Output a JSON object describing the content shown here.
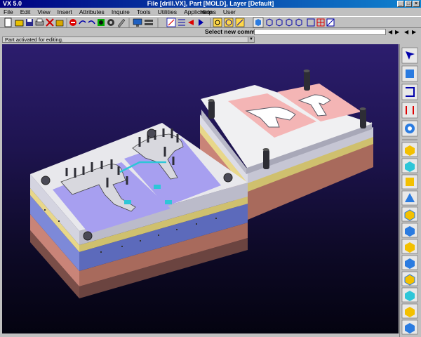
{
  "window": {
    "app_title": "VX 5.0",
    "doc_title": "File [drill.VX], Part [MOLD], Layer [Default]"
  },
  "menus": [
    "File",
    "Edit",
    "View",
    "Insert",
    "Attributes",
    "Inquire",
    "Tools",
    "Utilities",
    "Applications",
    "User"
  ],
  "help_menu": "Help",
  "command": {
    "label": "Select new command",
    "value": ""
  },
  "status": {
    "message": "Part activated for editing."
  },
  "colors": {
    "viewport_bg": "#1e1450",
    "plate_white": "#e8e8e8",
    "cavity_blue": "#a79ff0",
    "cavity_pink": "#f4b5b5",
    "base_brown": "#b07a6a",
    "plate_blue": "#7d89d8",
    "accent_cyan": "#2ec6d8"
  },
  "icons": {
    "toolbar": [
      "new-icon",
      "open-icon",
      "save-icon",
      "print-icon",
      "cut-icon",
      "folder-icon",
      "stop-icon",
      "redo-icon",
      "undo-icon",
      "move-icon",
      "gear-icon",
      "pencil-icon",
      "monitor-icon",
      "layer-icon",
      "cube-icon",
      "grid-icon",
      "red-icon",
      "zoom-icon",
      "view-iso-icon",
      "view-front-icon",
      "view-top-icon"
    ],
    "sidebar": [
      "pointer-icon",
      "shape-icon",
      "plane-icon",
      "line-icon",
      "sphere-icon",
      "extrude-icon",
      "revolve-icon",
      "sweep-icon",
      "loft-icon",
      "shell-icon",
      "fillet-icon",
      "chamfer-icon",
      "draft-icon",
      "split-icon",
      "mirror-icon",
      "pattern-icon",
      "combine-icon"
    ]
  }
}
